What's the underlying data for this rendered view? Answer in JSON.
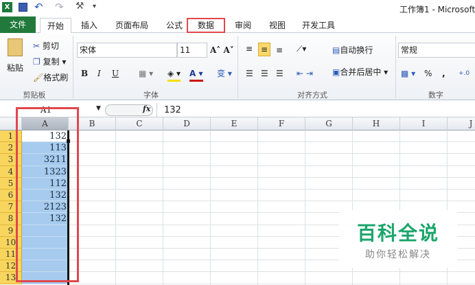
{
  "window": {
    "title": "工作簿1 - Microsoft"
  },
  "quick_access": [
    "excel-icon",
    "save-icon",
    "undo-icon",
    "redo-icon",
    "tools-icon",
    "customize-icon"
  ],
  "tabs": [
    {
      "label": "文件"
    },
    {
      "label": "开始"
    },
    {
      "label": "插入"
    },
    {
      "label": "页面布局"
    },
    {
      "label": "公式"
    },
    {
      "label": "数据"
    },
    {
      "label": "审阅"
    },
    {
      "label": "视图"
    },
    {
      "label": "开发工具"
    }
  ],
  "ribbon": {
    "clipboard": {
      "paste": "粘贴",
      "cut": "剪切",
      "copy": "复制",
      "format_painter": "格式刷",
      "label": "剪贴板"
    },
    "font": {
      "name": "宋体",
      "size": "11",
      "bold": "B",
      "italic": "I",
      "underline": "U",
      "label": "字体"
    },
    "alignment": {
      "wrap": "自动换行",
      "merge": "合并后居中",
      "label": "对齐方式"
    },
    "number": {
      "format": "常规",
      "percent": "%",
      "comma": ",",
      "label": "数字"
    }
  },
  "formula_bar": {
    "name_box": "A1",
    "fx": "fx",
    "value": "132"
  },
  "columns": [
    "A",
    "B",
    "C",
    "D",
    "E",
    "F",
    "G",
    "H",
    "I",
    "J"
  ],
  "rows": [
    "1",
    "2",
    "3",
    "4",
    "5",
    "6",
    "7",
    "8",
    "9",
    "10",
    "11",
    "12",
    "13"
  ],
  "column_a": [
    "132",
    "113",
    "3211",
    "1323",
    "112",
    "132",
    "2123",
    "132",
    "",
    "",
    "",
    "",
    ""
  ],
  "highlight_color": "#e0474c",
  "selection_color": "#a6cbee",
  "watermark": {
    "title": "百科全说",
    "subtitle": "助你轻松解决"
  }
}
